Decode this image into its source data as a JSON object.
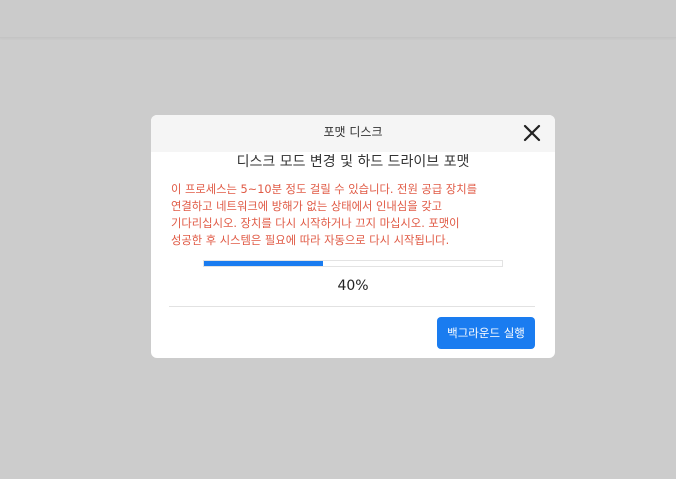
{
  "dialog": {
    "title": "포맷 디스크",
    "close_icon": "close-icon",
    "subtitle": "디스크 모드 변경 및 하드 드라이브 포맷",
    "warning": "이 프로세스는 5~10분 정도 걸릴 수 있습니다. 전원 공급 장치를\n연결하고 네트워크에 방해가 없는 상태에서 인내심을 갖고\n기다리십시오. 장치를 다시 시작하거나 끄지 마십시오. 포맷이\n성공한 후 시스템은 필요에 따라 자동으로 다시 시작됩니다.",
    "progress_value": 0.4,
    "progress_text": "40%",
    "background_run_label": "백그라운드 실행"
  },
  "colors": {
    "overlay": "#cccccc",
    "accent": "#1a7cf0",
    "warning": "#e05a45"
  }
}
